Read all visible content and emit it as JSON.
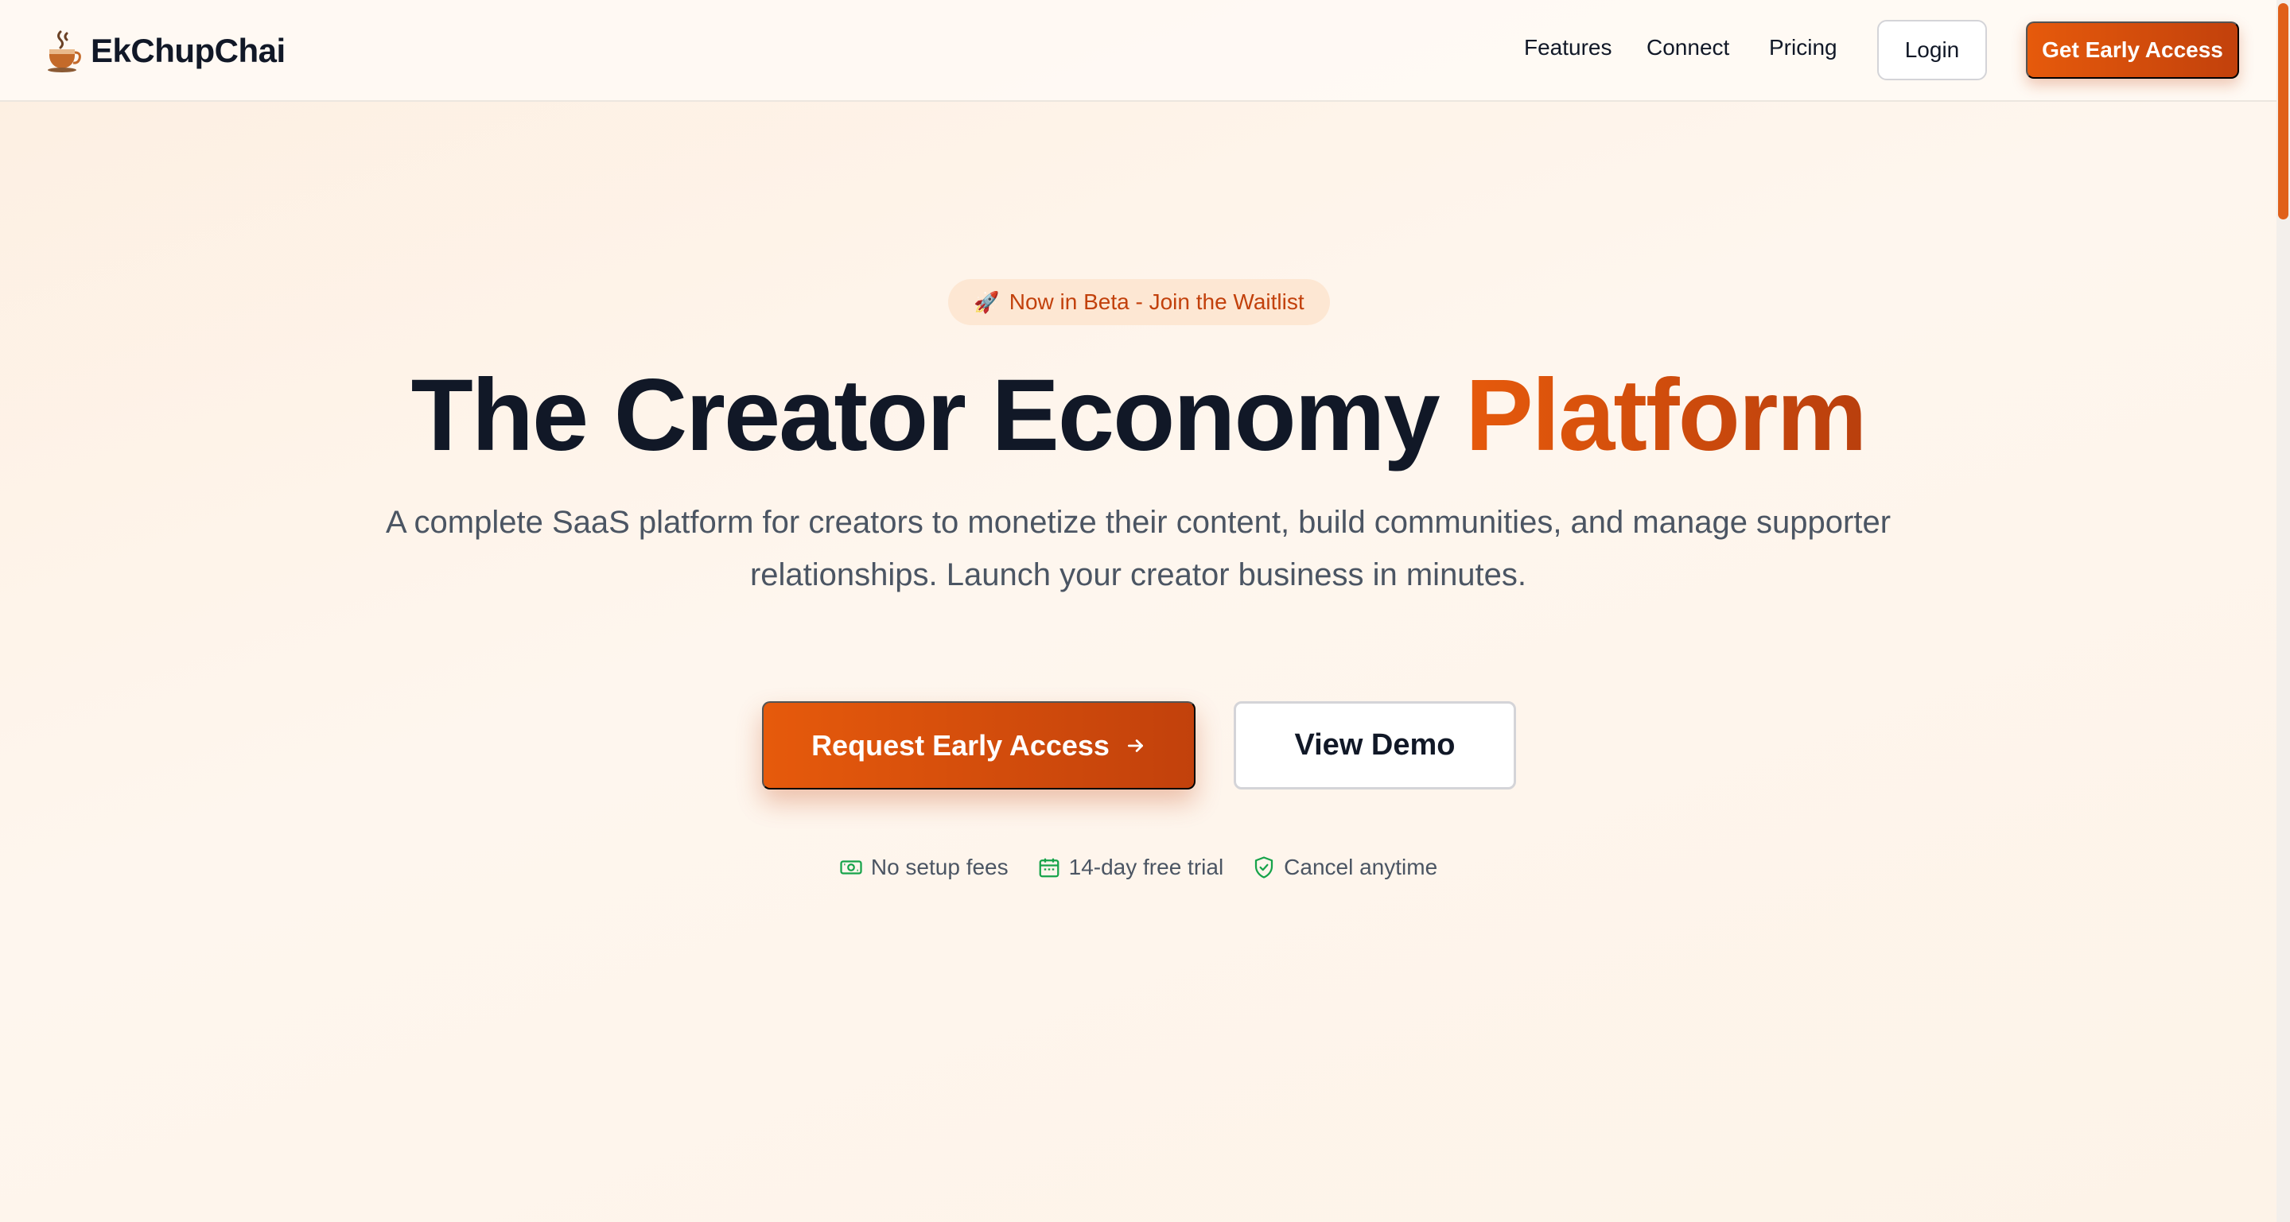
{
  "navbar": {
    "brand": {
      "name": "EkChupChai",
      "icon": "teacup-icon"
    },
    "links": [
      "Features",
      "Connect",
      "Pricing"
    ],
    "login_label": "Login",
    "cta_label": "Get Early Access"
  },
  "hero": {
    "badge": {
      "icon": "rocket-icon",
      "text": "Now in Beta - Join the Waitlist"
    },
    "title_main": "The Creator Economy ",
    "title_accent": "Platform",
    "subtitle_line1": "A complete SaaS platform for creators to monetize their content, build communities, and manage supporter",
    "subtitle_line2": "relationships. Launch your creator business in minutes.",
    "primary_cta": "Request Early Access",
    "primary_cta_icon": "arrow-right-icon",
    "secondary_cta": "View Demo",
    "features": [
      {
        "icon": "money-icon",
        "label": "No setup fees"
      },
      {
        "icon": "calendar-icon",
        "label": "14-day free trial"
      },
      {
        "icon": "shield-check-icon",
        "label": "Cancel anytime"
      }
    ]
  },
  "colors": {
    "accent": "#E65A0C",
    "accent_dark": "#C2410C",
    "feature_icon": "#16A34A",
    "text_primary": "#111827",
    "text_secondary": "#4B5563"
  }
}
